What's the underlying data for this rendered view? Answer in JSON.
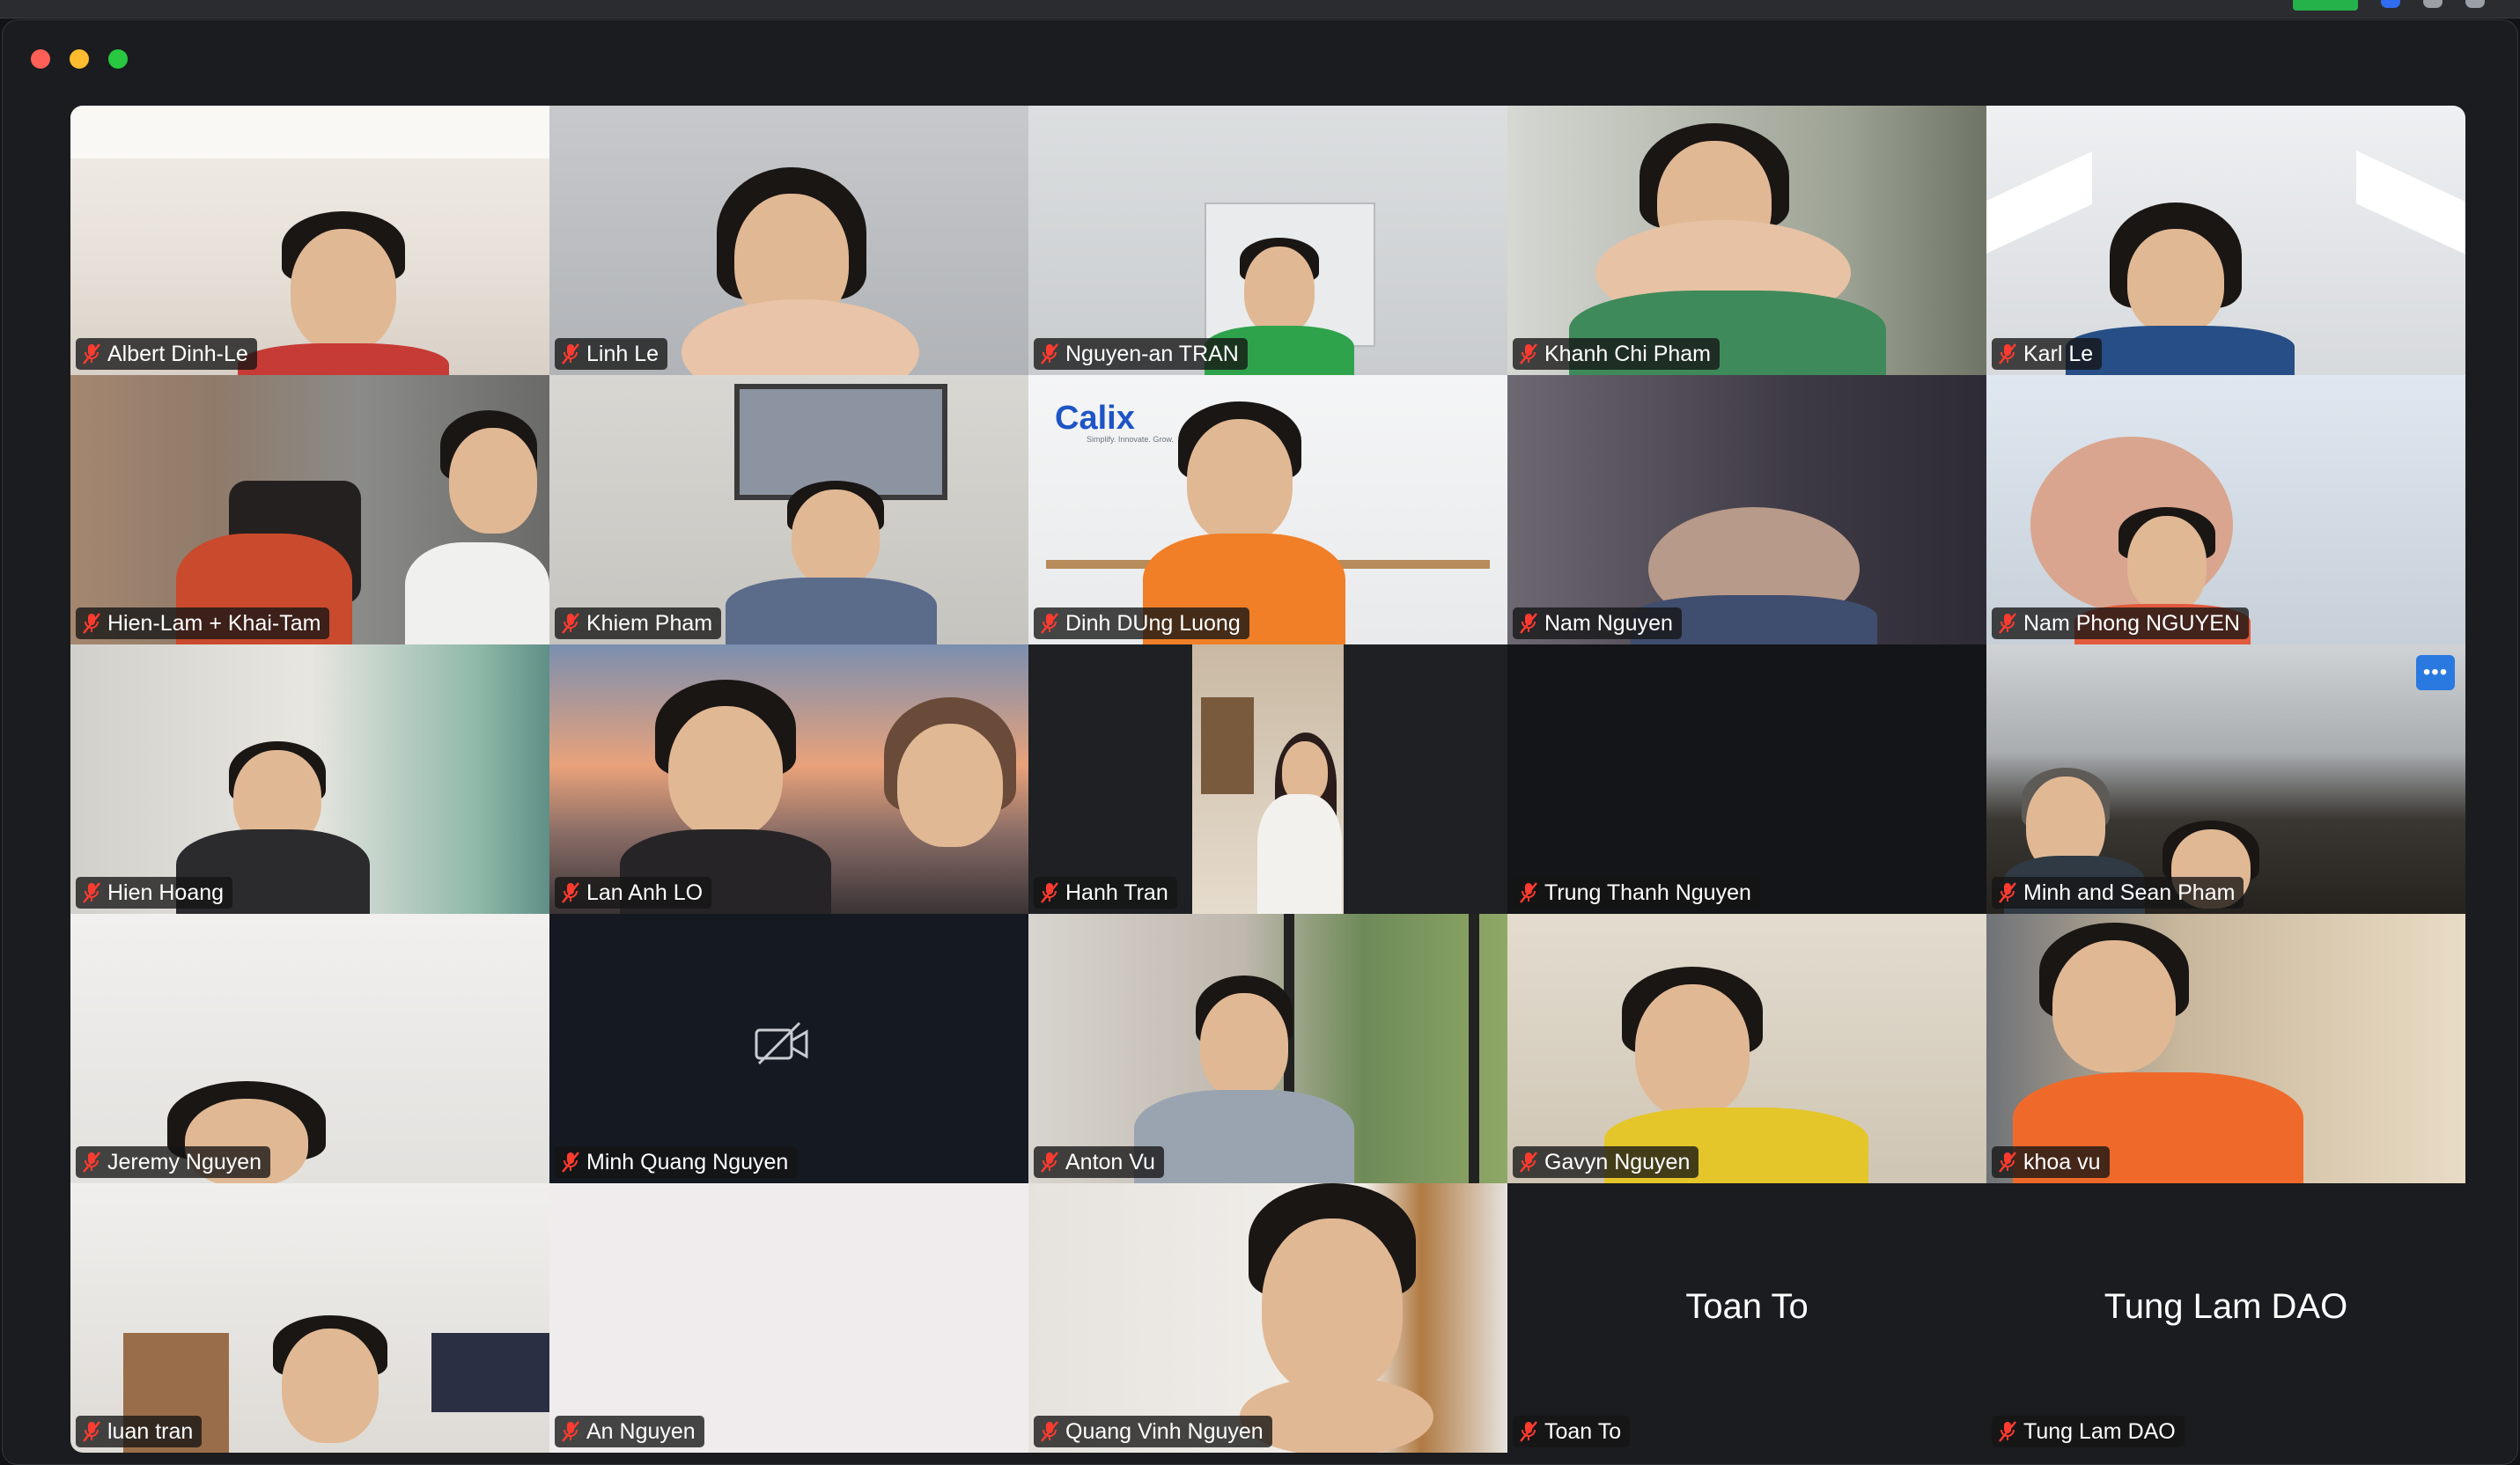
{
  "participants": [
    {
      "name": "Albert Dinh-Le"
    },
    {
      "name": "Linh Le"
    },
    {
      "name": "Nguyen-an TRAN"
    },
    {
      "name": "Khanh Chi Pham"
    },
    {
      "name": "Karl Le"
    },
    {
      "name": "Hien-Lam + Khai-Tam"
    },
    {
      "name": "Khiem Pham"
    },
    {
      "name": "Dinh DUng Luong"
    },
    {
      "name": "Nam Nguyen"
    },
    {
      "name": "Nam Phong NGUYEN"
    },
    {
      "name": "Hien Hoang"
    },
    {
      "name": "Lan Anh LO"
    },
    {
      "name": "Hanh Tran"
    },
    {
      "name": "Trung Thanh Nguyen"
    },
    {
      "name": "Minh and Sean Pham"
    },
    {
      "name": "Jeremy Nguyen"
    },
    {
      "name": "Minh Quang Nguyen"
    },
    {
      "name": "Anton Vu"
    },
    {
      "name": "Gavyn Nguyen"
    },
    {
      "name": "khoa vu"
    },
    {
      "name": "luan tran"
    },
    {
      "name": "An Nguyen"
    },
    {
      "name": "Quang Vinh Nguyen"
    },
    {
      "name": "Toan To",
      "big_label": "Toan To"
    },
    {
      "name": "Tung Lam DAO",
      "big_label": "Tung Lam DAO"
    }
  ],
  "tile_extras": {
    "more_button_label": "•••",
    "calix_logo_text": "Calix",
    "calix_tagline": "Simplify. Innovate. Grow."
  },
  "icons": {
    "mic": "mic-muted-icon",
    "camera": "camera-off-icon",
    "more": "more-options-icon"
  },
  "colors": {
    "muted_mic": "#ff3b30",
    "more_button": "#2a79e0",
    "window_bg": "#1a1c1f",
    "nametag_bg": "#141414"
  }
}
